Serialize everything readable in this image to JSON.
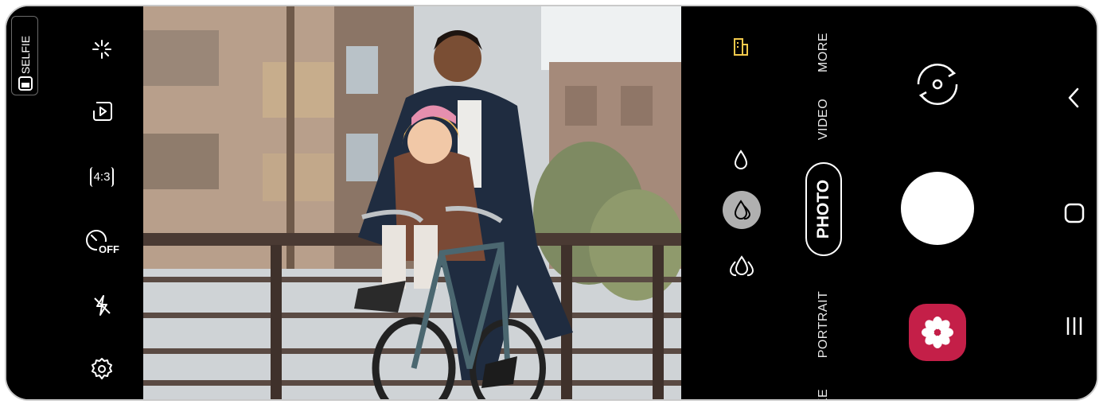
{
  "camera": {
    "selfie_label": "SELFIE",
    "modes": {
      "more": "MORE",
      "video": "VIDEO",
      "photo": "PHOTO",
      "portrait": "PORTRAIT",
      "partial": "KE"
    },
    "toolbar": {
      "aspect_ratio": "4:3",
      "timer": "OFF"
    },
    "icons": {
      "left": [
        "selfie-mode-icon",
        "effects-sparkle-icon",
        "motion-photo-icon",
        "aspect-ratio-icon",
        "timer-off-icon",
        "flash-off-icon",
        "settings-gear-icon"
      ],
      "right": [
        "scene-optimizer-icon",
        "single-lens-icon",
        "wide-lens-icon",
        "ultra-wide-lens-icon",
        "switch-camera-icon",
        "shutter-button",
        "gallery-icon"
      ],
      "nav": [
        "back-icon",
        "home-icon",
        "recents-icon"
      ]
    },
    "colors": {
      "gallery_accent": "#c41f48",
      "scene_optimizer": "#f2c94c",
      "background": "#000000"
    }
  }
}
